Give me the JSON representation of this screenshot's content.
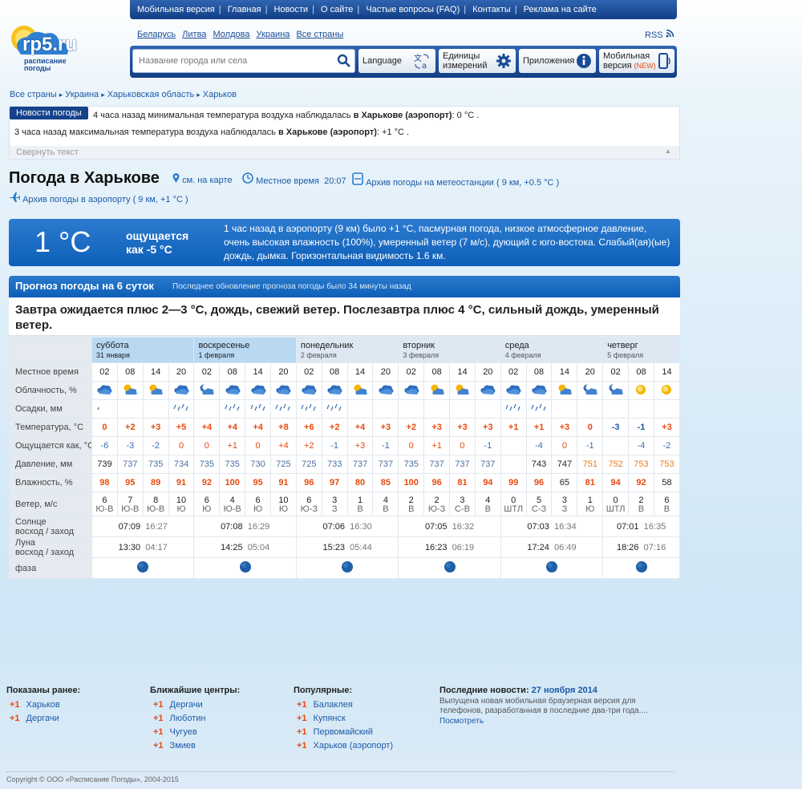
{
  "nav": {
    "items": [
      "Мобильная версия",
      "Главная",
      "Новости",
      "О сайте",
      "Частые вопросы (FAQ)",
      "Контакты",
      "Реклама на сайте"
    ]
  },
  "logo": {
    "name": "rp5.ru",
    "tagline1": "расписание",
    "tagline2": "погоды"
  },
  "countries": [
    "Беларусь",
    "Литва",
    "Молдова",
    "Украина",
    "Все страны"
  ],
  "rss": "RSS",
  "search": {
    "placeholder": "Название города или села"
  },
  "toolbar": {
    "language": "Language",
    "units_1": "Единицы",
    "units_2": "измерений",
    "apps": "Приложения",
    "mobile_1": "Мобильная",
    "mobile_2": "версия",
    "mobile_new": "(NEW)"
  },
  "breadcrumb": [
    "Все страны",
    "Украина",
    "Харьковская область",
    "Харьков"
  ],
  "news": {
    "button": "Новости погоды",
    "line1_pre": "4 часа назад минимальная температура воздуха наблюдалась",
    "line1_place": "в Харькове (аэропорт)",
    "line1_val": ": 0 °С .",
    "line2_pre": "3 часа назад максимальная температура воздуха наблюдалась",
    "line2_place": "в Харькове (аэропорт)",
    "line2_val": ": +1 °С .",
    "collapse": "Свернуть текст"
  },
  "header": {
    "title": "Погода в Харькове",
    "map_link": "см. на карте",
    "local_time_label": "Местное время",
    "local_time": "20:07",
    "archive_station": "Архив погоды на метеостанции ( 9 км, +0.5 °C )",
    "archive_airport": "Архив погоды в аэропорту ( 9 км, +1 °C )"
  },
  "current": {
    "temp": "1 °C",
    "feels_1": "ощущается",
    "feels_2": "как -5 °C",
    "desc": "1 час назад в аэропорту (9 км) было +1 °C, пасмурная погода, низкое атмосферное давление, очень высокая влажность (100%), умеренный ветер (7 м/с), дующий с юго-востока. Слабый(ая)(ые) дождь, дымка. Горизонтальная видимость 1.6 км."
  },
  "forecast": {
    "title": "Прогноз погоды на 6 суток",
    "updated": "Последнее обновление прогноза погоды было 34 минуты назад",
    "summary": "Завтра ожидается плюс 2—3 °C, дождь, свежий ветер. Послезавтра плюс 4 °C, сильный дождь, умеренный ветер.",
    "labels": {
      "time": "Местное время",
      "cloud": "Облачность, %",
      "precip": "Осадки, мм",
      "temp": "Температура, °C",
      "feels": "Ощущается как, °C",
      "pressure": "Давление, мм",
      "humidity": "Влажность, %",
      "wind": "Ветер, м/с",
      "sun_1": "Солнце",
      "sun_2": "восход / заход",
      "moon_1": "Луна",
      "moon_2": "восход / заход",
      "phase": "фаза"
    },
    "days": [
      {
        "name": "суббота",
        "date": "31 января",
        "active": true,
        "cols": 4,
        "times": [
          "02",
          "08",
          "14",
          "20"
        ],
        "cloud": [
          "rain-cloud",
          "sun-cloud",
          "sun-cloud",
          "rain-cloud"
        ],
        "precip": [
          "light",
          "",
          "",
          "drops"
        ],
        "temp": [
          "0",
          "+2",
          "+3",
          "+5"
        ],
        "feels": [
          "-6",
          "-3",
          "-2",
          "0"
        ],
        "pressure": [
          "739",
          "737",
          "735",
          "734"
        ],
        "humidity": [
          "98",
          "95",
          "89",
          "91"
        ],
        "wind": [
          "6",
          "7",
          "8",
          "10"
        ],
        "wdir": [
          "Ю-В",
          "Ю-В",
          "Ю-В",
          "Ю"
        ],
        "sun": [
          "07:09",
          "16:27"
        ],
        "moon": [
          "13:30",
          "04:17"
        ]
      },
      {
        "name": "воскресенье",
        "date": "1 февраля",
        "active": true,
        "cols": 4,
        "times": [
          "02",
          "08",
          "14",
          "20"
        ],
        "cloud": [
          "moon-cloud",
          "rain-cloud",
          "rain-cloud",
          "rain-cloud"
        ],
        "precip": [
          "",
          "drops",
          "drops",
          "drops"
        ],
        "temp": [
          "+4",
          "+4",
          "+4",
          "+8"
        ],
        "feels": [
          "0",
          "+1",
          "0",
          "+4"
        ],
        "pressure": [
          "735",
          "735",
          "730",
          "725"
        ],
        "humidity": [
          "92",
          "100",
          "95",
          "91"
        ],
        "wind": [
          "6",
          "4",
          "6",
          "10"
        ],
        "wdir": [
          "Ю",
          "Ю-В",
          "Ю",
          "Ю"
        ],
        "sun": [
          "07:08",
          "16:29"
        ],
        "moon": [
          "14:25",
          "05:04"
        ]
      },
      {
        "name": "понедельник",
        "date": "2 февраля",
        "active": false,
        "cols": 4,
        "times": [
          "02",
          "08",
          "14",
          "20"
        ],
        "cloud": [
          "rain-cloud",
          "rain-cloud",
          "sun-cloud",
          "rain-cloud"
        ],
        "precip": [
          "drops",
          "drops",
          "",
          ""
        ],
        "temp": [
          "+6",
          "+2",
          "+4",
          "+3"
        ],
        "feels": [
          "+2",
          "-1",
          "+3",
          "-1"
        ],
        "pressure": [
          "725",
          "733",
          "737",
          "737"
        ],
        "humidity": [
          "96",
          "97",
          "80",
          "85"
        ],
        "wind": [
          "6",
          "3",
          "1",
          "4"
        ],
        "wdir": [
          "Ю-З",
          "З",
          "В",
          "В"
        ],
        "sun": [
          "07:06",
          "16:30"
        ],
        "moon": [
          "15:23",
          "05:44"
        ]
      },
      {
        "name": "вторник",
        "date": "3 февраля",
        "active": false,
        "cols": 4,
        "times": [
          "02",
          "08",
          "14",
          "20"
        ],
        "cloud": [
          "rain-cloud",
          "sun-cloud",
          "sun-cloud",
          "rain-cloud"
        ],
        "precip": [
          "",
          "",
          "",
          ""
        ],
        "temp": [
          "+2",
          "+3",
          "+3",
          "+3"
        ],
        "feels": [
          "0",
          "+1",
          "0",
          "-1"
        ],
        "pressure": [
          "735",
          "737",
          "737",
          "737"
        ],
        "humidity": [
          "100",
          "96",
          "81",
          "94"
        ],
        "wind": [
          "2",
          "2",
          "3",
          "4"
        ],
        "wdir": [
          "В",
          "Ю-З",
          "С-В",
          "В"
        ],
        "sun": [
          "07:05",
          "16:32"
        ],
        "moon": [
          "16:23",
          "06:19"
        ]
      },
      {
        "name": "среда",
        "date": "4 февраля",
        "active": false,
        "cols": 4,
        "times": [
          "02",
          "08",
          "14",
          "20"
        ],
        "cloud": [
          "rain-cloud",
          "rain-cloud",
          "sun-cloud",
          "moon-cloud"
        ],
        "precip": [
          "drops",
          "drops",
          "",
          ""
        ],
        "temp": [
          "+1",
          "+1",
          "+3",
          "0"
        ],
        "feels": [
          "",
          "-4",
          "0",
          "-1"
        ],
        "pressure": [
          "",
          "743",
          "747",
          "751"
        ],
        "humidity": [
          "99",
          "96",
          "65",
          "81"
        ],
        "wind": [
          "0",
          "5",
          "3",
          "1"
        ],
        "wdir": [
          "ШТЛ",
          "С-З",
          "З",
          "Ю"
        ],
        "sun": [
          "07:03",
          "16:34"
        ],
        "moon": [
          "17:24",
          "06:49"
        ]
      },
      {
        "name": "четверг",
        "date": "5 февраля",
        "active": false,
        "cols": 3,
        "times": [
          "02",
          "08",
          "14"
        ],
        "cloud": [
          "moon-cloud",
          "sun",
          "sun"
        ],
        "precip": [
          "",
          "",
          ""
        ],
        "temp": [
          "-3",
          "-1",
          "+3"
        ],
        "feels": [
          "",
          "-4",
          "-2"
        ],
        "pressure": [
          "752",
          "753",
          "753"
        ],
        "humidity": [
          "94",
          "92",
          "58"
        ],
        "wind": [
          "0",
          "2",
          "6"
        ],
        "wdir": [
          "ШТЛ",
          "В",
          "В"
        ],
        "sun": [
          "07:01",
          "16:35"
        ],
        "moon": [
          "18:26",
          "07:16"
        ]
      }
    ]
  },
  "footer": {
    "shown_title": "Показаны ранее:",
    "shown": [
      {
        "d": "+1",
        "n": "Харьков"
      },
      {
        "d": "+1",
        "n": "Дергачи"
      }
    ],
    "near_title": "Ближайшие центры:",
    "near": [
      {
        "d": "+1",
        "n": "Дергачи"
      },
      {
        "d": "+1",
        "n": "Люботин"
      },
      {
        "d": "+1",
        "n": "Чугуев"
      },
      {
        "d": "+1",
        "n": "Змиев"
      }
    ],
    "pop_title": "Популярные:",
    "pop": [
      {
        "d": "+1",
        "n": "Балаклея"
      },
      {
        "d": "+1",
        "n": "Купянск"
      },
      {
        "d": "+1",
        "n": "Первомайский"
      },
      {
        "d": "+1",
        "n": "Харьков (аэропорт)"
      }
    ],
    "latest_title": "Последние новости:",
    "latest_date": "27 ноября 2014",
    "latest_text": "Выпущена новая мобильная браузерная версия для телефонов, разработанная в последние два-три года....",
    "latest_link": "Посмотреть",
    "copyright": "Copyright © ООО «Расписание Погоды», 2004-2015"
  }
}
